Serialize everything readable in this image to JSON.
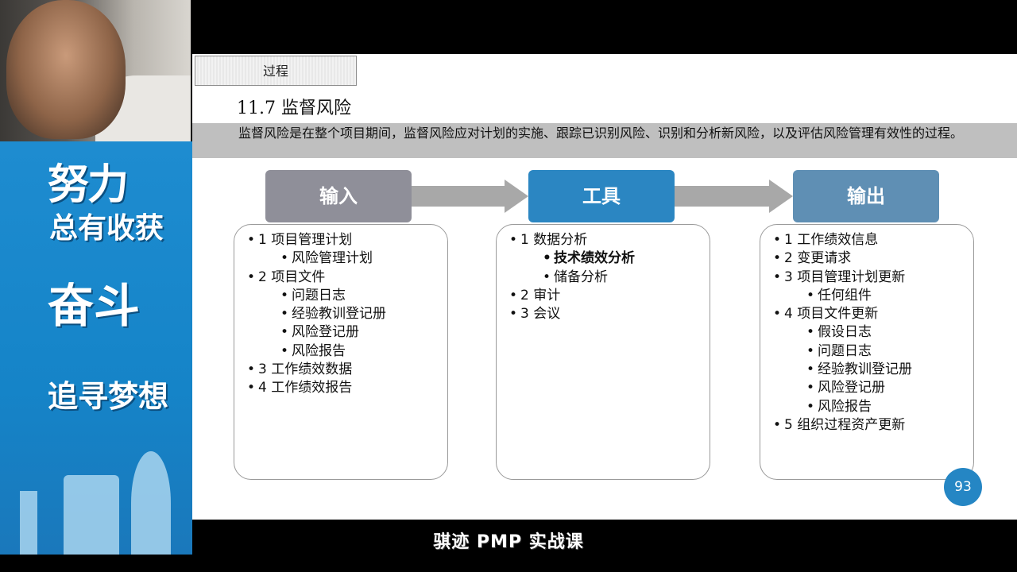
{
  "slide": {
    "tag": "过程",
    "title": "11.7  监督风险",
    "description": "监督风险是在整个项目期间，监督风险应对计划的实施、跟踪已识别风险、识别和分析新风险，以及评估风险管理有效性的过程。",
    "headers": {
      "input": "输入",
      "tools": "工具",
      "output": "输出"
    },
    "inputs": [
      {
        "level": 0,
        "text": "1 项目管理计划"
      },
      {
        "level": 1,
        "text": "风险管理计划"
      },
      {
        "level": 0,
        "text": "2 项目文件"
      },
      {
        "level": 1,
        "text": "问题日志"
      },
      {
        "level": 1,
        "text": "经验教训登记册"
      },
      {
        "level": 1,
        "text": "风险登记册"
      },
      {
        "level": 1,
        "text": "风险报告"
      },
      {
        "level": 0,
        "text": "3 工作绩效数据"
      },
      {
        "level": 0,
        "text": "4 工作绩效报告"
      }
    ],
    "tools": [
      {
        "level": 0,
        "text": "1 数据分析"
      },
      {
        "level": 1,
        "text": "技术绩效分析",
        "bold": true
      },
      {
        "level": 1,
        "text": "储备分析"
      },
      {
        "level": 0,
        "text": "2 审计"
      },
      {
        "level": 0,
        "text": "3 会议"
      }
    ],
    "outputs": [
      {
        "level": 0,
        "text": "1 工作绩效信息"
      },
      {
        "level": 0,
        "text": "2 变更请求"
      },
      {
        "level": 0,
        "text": "3 项目管理计划更新"
      },
      {
        "level": 1,
        "text": "任何组件"
      },
      {
        "level": 0,
        "text": "4 项目文件更新"
      },
      {
        "level": 1,
        "text": "假设日志"
      },
      {
        "level": 1,
        "text": "问题日志"
      },
      {
        "level": 1,
        "text": "经验教训登记册"
      },
      {
        "level": 1,
        "text": "风险登记册"
      },
      {
        "level": 1,
        "text": "风险报告"
      },
      {
        "level": 0,
        "text": "5 组织过程资产更新"
      }
    ],
    "page_number": "93"
  },
  "poster": {
    "line1": "努力",
    "line2": "总有收获",
    "line3": "奋斗",
    "line4": "追寻梦想"
  },
  "caption": "骐迹 PMP 实战课",
  "colors": {
    "input_header": "#8f8f99",
    "tools_header": "#2b86c2",
    "output_header": "#5f8fb4",
    "page_badge": "#2586c4",
    "poster_bg": "#1e8cd0"
  }
}
